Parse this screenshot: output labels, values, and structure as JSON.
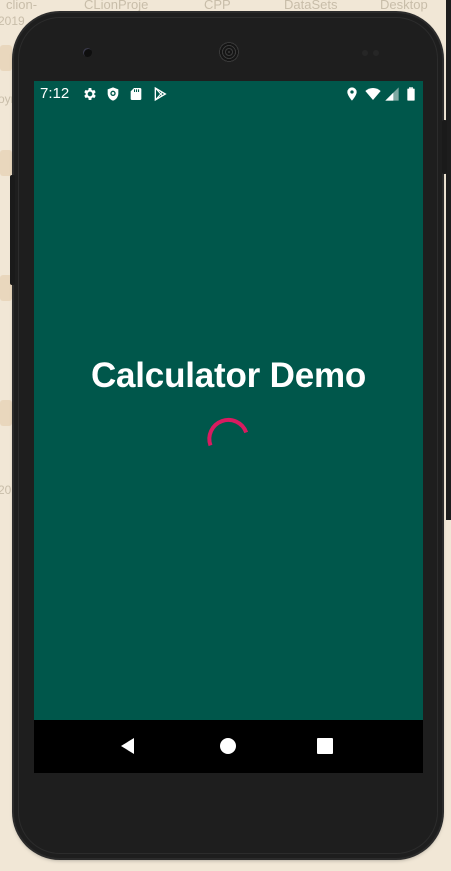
{
  "background_desktop": {
    "top_labels": [
      "clion-",
      "CLionProje",
      "CPP",
      "DataSets",
      "Desktop"
    ],
    "left_fragments": [
      "2019",
      "oyr",
      "2019"
    ]
  },
  "status_bar": {
    "time": "7:12",
    "left_icons": [
      "settings-icon",
      "shield-icon",
      "sd-card-icon",
      "play-store-icon"
    ],
    "right_icons": [
      "location-icon",
      "wifi-icon",
      "signal-icon",
      "battery-icon"
    ]
  },
  "app": {
    "title": "Calculator Demo",
    "spinner_color": "#d81b60",
    "background_color": "#00574b"
  },
  "nav_bar": {
    "buttons": [
      "back",
      "home",
      "recents"
    ]
  }
}
